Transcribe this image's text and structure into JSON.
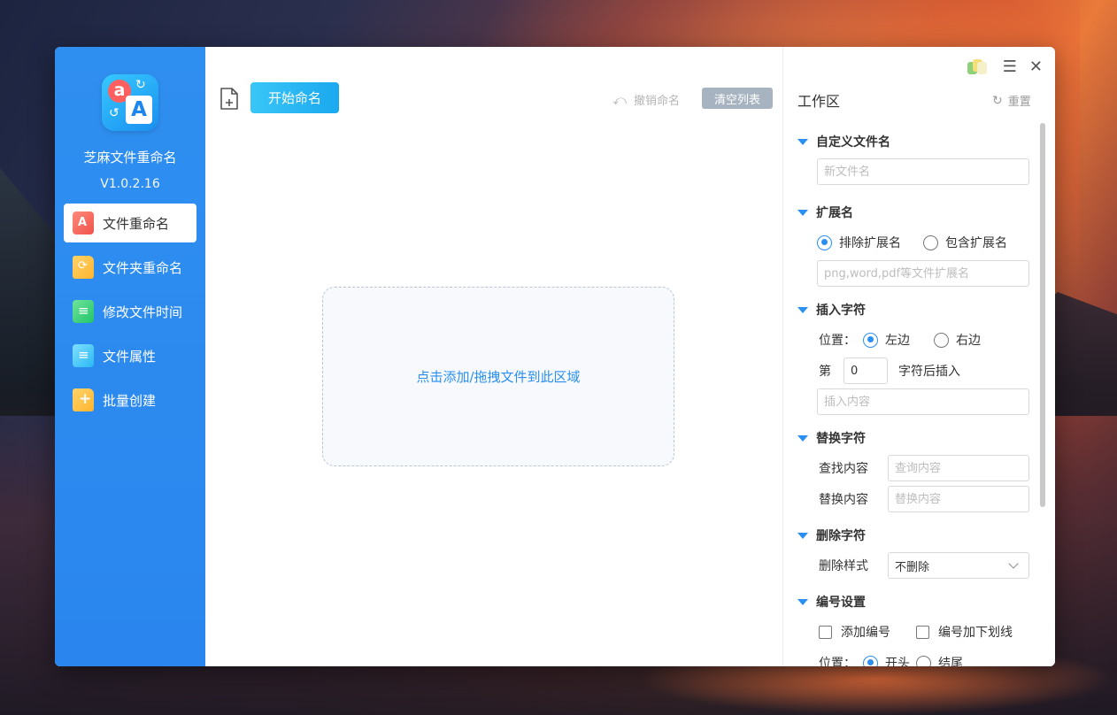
{
  "app": {
    "name": "芝麻文件重命名",
    "version": "V1.0.2.16"
  },
  "sidebar": {
    "items": [
      {
        "label": "文件重命名",
        "icon": "rename-file-icon",
        "active": true
      },
      {
        "label": "文件夹重命名",
        "icon": "folder-rename-icon",
        "active": false
      },
      {
        "label": "修改文件时间",
        "icon": "file-time-icon",
        "active": false
      },
      {
        "label": "文件属性",
        "icon": "file-attributes-icon",
        "active": false
      },
      {
        "label": "批量创建",
        "icon": "batch-create-icon",
        "active": false
      }
    ]
  },
  "toolbar": {
    "start_label": "开始命名",
    "undo_label": "撤销命名",
    "clear_label": "清空列表"
  },
  "dropzone": {
    "text": "点击添加/拖拽文件到此区域"
  },
  "workpanel": {
    "title": "工作区",
    "reset_label": "重置",
    "custom_name": {
      "title": "自定义文件名",
      "placeholder": "新文件名"
    },
    "extension": {
      "title": "扩展名",
      "exclude_label": "排除扩展名",
      "include_label": "包含扩展名",
      "placeholder": "png,word,pdf等文件扩展名"
    },
    "insert": {
      "title": "插入字符",
      "position_label": "位置：",
      "left_label": "左边",
      "right_label": "右边",
      "nth_label": "第",
      "nth_value": "0",
      "after_label": "字符后插入",
      "placeholder": "插入内容"
    },
    "replace": {
      "title": "替换字符",
      "find_label": "查找内容",
      "find_placeholder": "查询内容",
      "replace_label": "替换内容",
      "replace_placeholder": "替换内容"
    },
    "delete": {
      "title": "删除字符",
      "style_label": "删除样式",
      "style_value": "不删除"
    },
    "numbering": {
      "title": "编号设置",
      "add_label": "添加编号",
      "underscore_label": "编号加下划线",
      "position_label": "位置：",
      "start_label": "开头",
      "end_label": "结尾"
    }
  },
  "colors": {
    "sidebar": "#2f8ff0",
    "accent": "#2a8ff0",
    "start_button": "#1aa8ef",
    "clear_button": "#a7b3c1"
  }
}
